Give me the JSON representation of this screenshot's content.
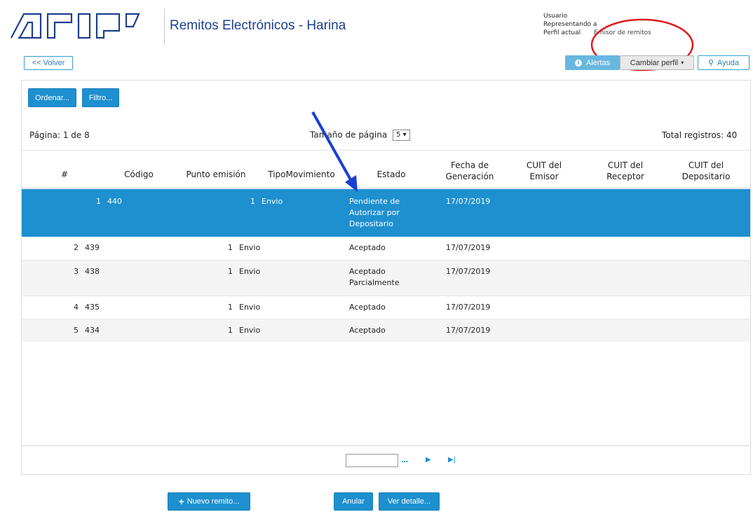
{
  "header": {
    "logo_text": "AFIP",
    "title": "Remitos Electrónicos - Harina",
    "user": {
      "usuario_label": "Usuario",
      "usuario_value": "",
      "representando_label": "Representando a",
      "representando_value": "",
      "perfil_label": "Perfil actual",
      "perfil_value": "Emisor de remitos"
    }
  },
  "toolbar": {
    "back_label": "<< Volver",
    "alertas_label": "Alertas",
    "cambiar_perfil_label": "Cambiar perfil",
    "ayuda_label": "Ayuda",
    "ordenar_label": "Ordenar...",
    "filtro_label": "Filtro..."
  },
  "paging": {
    "page_label": "Página:",
    "page_value": "1 de 8",
    "page_size_label": "Tamaño de página",
    "page_size_value": "5",
    "total_label": "Total registros:",
    "total_value": "40"
  },
  "table": {
    "columns": [
      "#",
      "Código",
      "Punto emisión",
      "TipoMovimiento",
      "Estado",
      "Fecha de Generación",
      "CUIT del Emisor",
      "CUIT del Receptor",
      "CUIT del Depositario"
    ],
    "rows": [
      {
        "num": "1",
        "codigo": "440",
        "punto": "1",
        "tipo": "Envio",
        "estado": "Pendiente de Autorizar por Depositario",
        "fecha": "17/07/2019",
        "emisor": "",
        "receptor": "",
        "depositario": "",
        "selected": true
      },
      {
        "num": "2",
        "codigo": "439",
        "punto": "1",
        "tipo": "Envio",
        "estado": "Aceptado",
        "fecha": "17/07/2019",
        "emisor": "",
        "receptor": "",
        "depositario": "",
        "selected": false
      },
      {
        "num": "3",
        "codigo": "438",
        "punto": "1",
        "tipo": "Envio",
        "estado": "Aceptado Parcialmente",
        "fecha": "17/07/2019",
        "emisor": "",
        "receptor": "",
        "depositario": "",
        "selected": false
      },
      {
        "num": "4",
        "codigo": "435",
        "punto": "1",
        "tipo": "Envio",
        "estado": "Aceptado",
        "fecha": "17/07/2019",
        "emisor": "",
        "receptor": "",
        "depositario": "",
        "selected": false
      },
      {
        "num": "5",
        "codigo": "434",
        "punto": "1",
        "tipo": "Envio",
        "estado": "Aceptado",
        "fecha": "17/07/2019",
        "emisor": "",
        "receptor": "",
        "depositario": "",
        "selected": false
      }
    ]
  },
  "pager": {
    "goto_label": "...",
    "next_icon": "play-icon",
    "last_icon": "last-page-icon"
  },
  "actions": {
    "nuevo_label": "Nuevo remito...",
    "anular_label": "Anular",
    "ver_detalle_label": "Ver detalle..."
  },
  "colors": {
    "accent": "#1e8fcf",
    "selected_row": "#1e8fcf",
    "annotation_ring": "#e0191c",
    "annotation_arrow": "#1a3fd6"
  }
}
